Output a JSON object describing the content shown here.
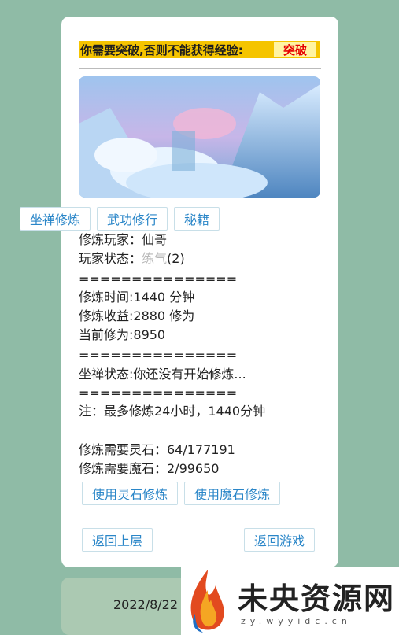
{
  "notice": {
    "text": "你需要突破,否则不能获得经验:",
    "break_label": "突破"
  },
  "tabs": [
    "坐禅修炼",
    "武功修行",
    "秘籍"
  ],
  "player": {
    "name_label": "修炼玩家：",
    "name": "仙哥",
    "status_label": "玩家状态：",
    "status_level": "练气",
    "status_suffix": "(2)"
  },
  "divider": "===============",
  "stats": {
    "time": "修炼时间:1440 分钟",
    "gain": "修炼收益:2880 修为",
    "current": "当前修为:8950"
  },
  "meditation_status": "坐禅状态:你还没有开始修炼...",
  "note": "注：最多修炼24小时，1440分钟",
  "costs": {
    "spirit": "修炼需要灵石：64/177191",
    "demon": "修炼需要魔石：2/99650"
  },
  "actions": {
    "use_spirit": "使用灵石修炼",
    "use_demon": "使用魔石修炼"
  },
  "nav": {
    "back": "返回上层",
    "game": "返回游戏"
  },
  "footer": {
    "date": "2022/8/22"
  },
  "watermark": {
    "title": "未央资源网",
    "url": "zy.wyyidc.cn"
  },
  "colors": {
    "page_bg": "#8fbba6",
    "notice_bg": "#f5c400",
    "break_text": "#e60000",
    "link": "#2a86c8"
  }
}
